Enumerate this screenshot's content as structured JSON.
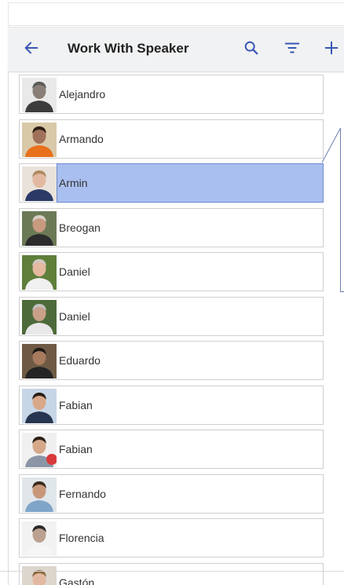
{
  "appbar": {
    "title": "Work With Speaker",
    "icons": {
      "back": "arrow-left-icon",
      "search": "search-icon",
      "filter": "filter-icon",
      "add": "plus-icon"
    },
    "accent_color": "#3a57b5"
  },
  "speakers": [
    {
      "name": "Alejandro",
      "selected": false
    },
    {
      "name": "Armando",
      "selected": false
    },
    {
      "name": "Armin",
      "selected": true
    },
    {
      "name": "Breogan",
      "selected": false
    },
    {
      "name": "Daniel",
      "selected": false
    },
    {
      "name": "Daniel",
      "selected": false
    },
    {
      "name": "Eduardo",
      "selected": false
    },
    {
      "name": "Fabian",
      "selected": false
    },
    {
      "name": "Fabian",
      "selected": false
    },
    {
      "name": "Fernando",
      "selected": false
    },
    {
      "name": "Florencia",
      "selected": false
    },
    {
      "name": "Gastón",
      "selected": false
    }
  ],
  "colors": {
    "selected_row": "#a9bfef",
    "selected_border": "#6d89d1"
  }
}
